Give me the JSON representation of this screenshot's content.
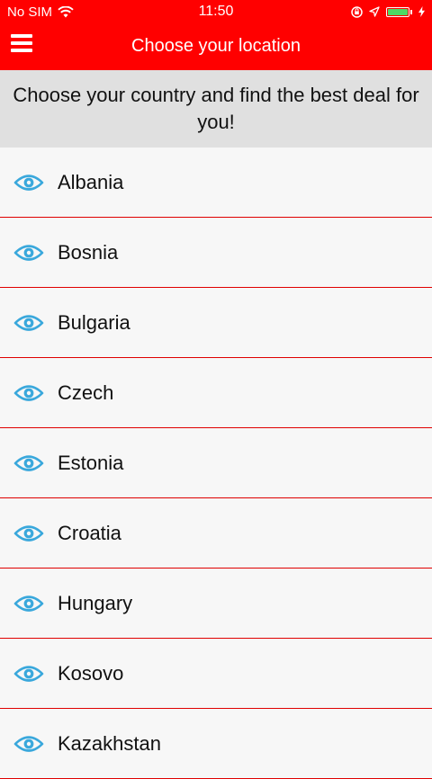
{
  "status_bar": {
    "carrier": "No SIM",
    "time": "11:50"
  },
  "header": {
    "title": "Choose your location",
    "color": "#ff0000"
  },
  "banner": {
    "text": "Choose your country and find the best deal for you!"
  },
  "list": {
    "icon": "eye-icon",
    "icon_color": "#3aa8dc",
    "items": [
      {
        "label": "Albania"
      },
      {
        "label": "Bosnia"
      },
      {
        "label": "Bulgaria"
      },
      {
        "label": "Czech"
      },
      {
        "label": "Estonia"
      },
      {
        "label": "Croatia"
      },
      {
        "label": "Hungary"
      },
      {
        "label": "Kosovo"
      },
      {
        "label": "Kazakhstan"
      }
    ]
  }
}
